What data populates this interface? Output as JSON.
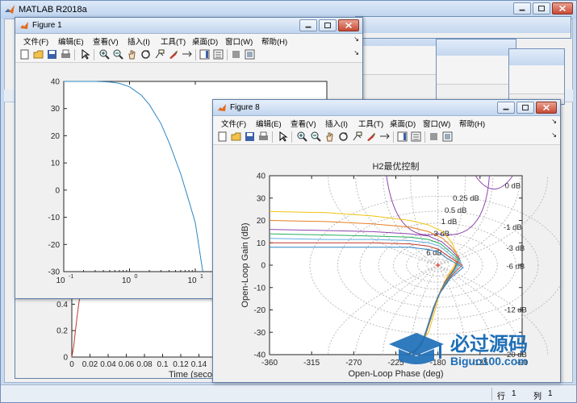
{
  "app": {
    "title": "MATLAB R2018a"
  },
  "status": {
    "row_label": "行",
    "row_value": "1",
    "col_label": "列",
    "col_value": "1"
  },
  "menu_items": [
    "文件(F)",
    "编辑(E)",
    "查看(V)",
    "插入(I)",
    "工具(T)",
    "桌面(D)",
    "窗口(W)",
    "帮助(H)"
  ],
  "toolbar_icons": [
    "new-figure-icon",
    "open-icon",
    "save-icon",
    "print-icon",
    "edit-plot-icon",
    "zoom-in-icon",
    "zoom-out-icon",
    "pan-icon",
    "rotate-icon",
    "data-cursor-icon",
    "brush-icon",
    "link-plot-icon",
    "colorbar-icon",
    "legend-icon",
    "hide-tools-icon",
    "show-tools-icon"
  ],
  "figure1": {
    "title": "Figure 1",
    "chart_data": {
      "type": "line",
      "title": "",
      "xscale": "log",
      "xlim": [
        0.1,
        1000
      ],
      "ylim": [
        -30,
        40
      ],
      "xticks": [
        "10",
        "10",
        "10"
      ],
      "xtick_exponents": [
        "-1",
        "0",
        "1"
      ],
      "yticks": [
        "40",
        "30",
        "20",
        "10",
        "0",
        "-10",
        "-20",
        "-30"
      ],
      "series": [
        {
          "color": "#2e86c1",
          "x": [
            0.1,
            0.3,
            0.5,
            0.7,
            1.0,
            1.5,
            2.0,
            3.0,
            4.0,
            6.0,
            8.0,
            10.0,
            13.0
          ],
          "y": [
            40,
            40,
            39.8,
            39.3,
            38.0,
            35.0,
            31.5,
            24.5,
            17.5,
            6.0,
            -4.0,
            -12.0,
            -30.0
          ]
        }
      ]
    }
  },
  "figure_bottom": {
    "chart_data": {
      "type": "line",
      "xlabel": "Time (seco",
      "xlim": [
        0,
        0.2
      ],
      "ylim": [
        0,
        0.5
      ],
      "xticks": [
        "0",
        "0.02",
        "0.04",
        "0.06",
        "0.08",
        "0.1",
        "0.12",
        "0.14"
      ],
      "yticks": [
        "0.4",
        "0.2",
        "0"
      ],
      "series": [
        {
          "color": "#c0392b",
          "x": [
            0.0,
            0.002,
            0.004,
            0.006,
            0.008,
            0.01,
            0.012
          ],
          "y": [
            0.0,
            0.08,
            0.2,
            0.32,
            0.42,
            0.49,
            0.52
          ]
        }
      ]
    }
  },
  "figure8": {
    "title": "Figure 8",
    "chart_data": {
      "type": "line",
      "title": "H2最优控制",
      "xlabel": "Open-Loop Phase (deg)",
      "ylabel": "Open-Loop Gain (dB)",
      "xlim": [
        -360,
        -90
      ],
      "ylim": [
        -40,
        40
      ],
      "xticks": [
        "-360",
        "-315",
        "-270",
        "-225",
        "-180",
        "-135",
        "-90"
      ],
      "yticks": [
        "40",
        "30",
        "20",
        "10",
        "0",
        "-10",
        "-20",
        "-30",
        "-40"
      ],
      "grid_labels": [
        {
          "text": "0 dB",
          "phase": -100,
          "gain": 35.5
        },
        {
          "text": "0.25 dB",
          "phase": -150,
          "gain": 30
        },
        {
          "text": "0.5 dB",
          "phase": -161,
          "gain": 24.5
        },
        {
          "text": "1 dB",
          "phase": -168,
          "gain": 19.5
        },
        {
          "text": "-1 dB",
          "phase": -100,
          "gain": 17
        },
        {
          "text": "3 dB",
          "phase": -176,
          "gain": 14
        },
        {
          "text": "-3 dB",
          "phase": -97,
          "gain": 7.5
        },
        {
          "text": "6 dB",
          "phase": -184,
          "gain": 5.5
        },
        {
          "text": "-6 dB",
          "phase": -97,
          "gain": -0.5
        },
        {
          "text": "-12 dB",
          "phase": -97,
          "gain": -20
        },
        {
          "text": "-20 dB",
          "phase": -97,
          "gain": -40
        }
      ],
      "series": [
        {
          "color": "#f1c40f",
          "x": [
            -360,
            -300,
            -250,
            -210,
            -190,
            -175,
            -165,
            -160,
            -162,
            -170,
            -178,
            -183,
            -190,
            -200,
            -210
          ],
          "y": [
            24,
            23.5,
            22,
            20,
            18,
            15,
            10,
            5,
            0,
            -5,
            -12,
            -20,
            -30,
            -36,
            -40
          ]
        },
        {
          "color": "#e67e22",
          "x": [
            -360,
            -300,
            -250,
            -210,
            -190,
            -175,
            -165,
            -158,
            -162,
            -172,
            -180,
            -186,
            -193,
            -202,
            -212
          ],
          "y": [
            20,
            19.5,
            18.5,
            17,
            15,
            12,
            8,
            4,
            -1,
            -7,
            -14,
            -22,
            -31,
            -37,
            -40
          ]
        },
        {
          "color": "#8e44ad",
          "x": [
            -360,
            -300,
            -250,
            -210,
            -190,
            -176,
            -166,
            -157,
            -163,
            -173,
            -181,
            -187,
            -194,
            -203,
            -213
          ],
          "y": [
            16,
            15.5,
            15,
            14,
            13,
            10.5,
            7,
            3,
            -2,
            -8,
            -15,
            -23,
            -32,
            -38,
            -40
          ]
        },
        {
          "color": "#27ae60",
          "x": [
            -360,
            -300,
            -250,
            -210,
            -190,
            -177,
            -167,
            -156,
            -164,
            -174,
            -182,
            -188,
            -195,
            -204,
            -214
          ],
          "y": [
            14,
            13.5,
            13,
            12.5,
            11.5,
            9.5,
            6,
            2,
            -3,
            -9,
            -16,
            -24,
            -33,
            -38,
            -40
          ]
        },
        {
          "color": "#5dade2",
          "x": [
            -360,
            -300,
            -250,
            -210,
            -190,
            -178,
            -168,
            -155,
            -165,
            -175,
            -183,
            -189,
            -196,
            -205,
            -215
          ],
          "y": [
            12,
            11.5,
            11.5,
            11,
            10,
            8.5,
            5,
            1,
            -4,
            -10,
            -17,
            -25,
            -34,
            -39,
            -40
          ]
        },
        {
          "color": "#c0392b",
          "x": [
            -360,
            -300,
            -250,
            -210,
            -190,
            -179,
            -169,
            -154,
            -166,
            -176,
            -184,
            -190,
            -197,
            -206,
            -216
          ],
          "y": [
            10,
            10,
            10,
            9.5,
            8.5,
            7,
            4,
            0,
            -5,
            -11,
            -18,
            -26,
            -35,
            -39,
            -40
          ]
        },
        {
          "color": "#2e86c1",
          "x": [
            -360,
            -300,
            -250,
            -210,
            -190,
            -180,
            -170,
            -153,
            -167,
            -177,
            -185,
            -191,
            -198,
            -207,
            -217
          ],
          "y": [
            8,
            8,
            8,
            8,
            7,
            6,
            3,
            -1,
            -6,
            -12,
            -19,
            -27,
            -36,
            -40,
            -40
          ]
        }
      ],
      "marker": {
        "phase": -180,
        "gain": 0,
        "color": "#e74c3c"
      }
    }
  }
}
